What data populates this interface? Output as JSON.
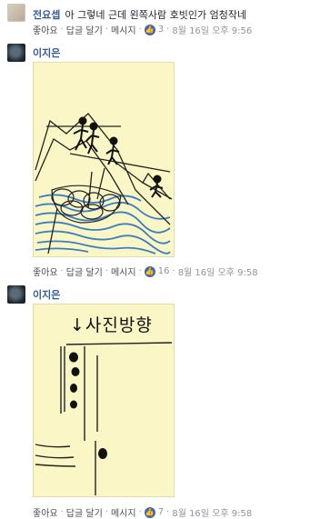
{
  "comments": [
    {
      "author": "전요셉",
      "text": "아 그렇네 근데 왼쪽사람 호빗인가 엄청작네",
      "actions": {
        "like": "좋아요",
        "reply": "답글 달기",
        "message": "메시지"
      },
      "like_count": "3",
      "time": "8월 16일 오후 9:56"
    },
    {
      "author": "이지은",
      "actions": {
        "like": "좋아요",
        "reply": "답글 달기",
        "message": "메시지"
      },
      "like_count": "16",
      "time": "8월 16일 오후 9:58"
    },
    {
      "author": "이지은",
      "drawing_text": "↓사진방향",
      "actions": {
        "like": "좋아요",
        "reply": "답글 달기",
        "message": "메시지"
      },
      "like_count": "7",
      "time": "8월 16일 오후 9:58"
    }
  ],
  "colors": {
    "link": "#365899",
    "meta": "#90949c",
    "like_badge": "#4267b2",
    "paper": "#fbf6c6"
  }
}
